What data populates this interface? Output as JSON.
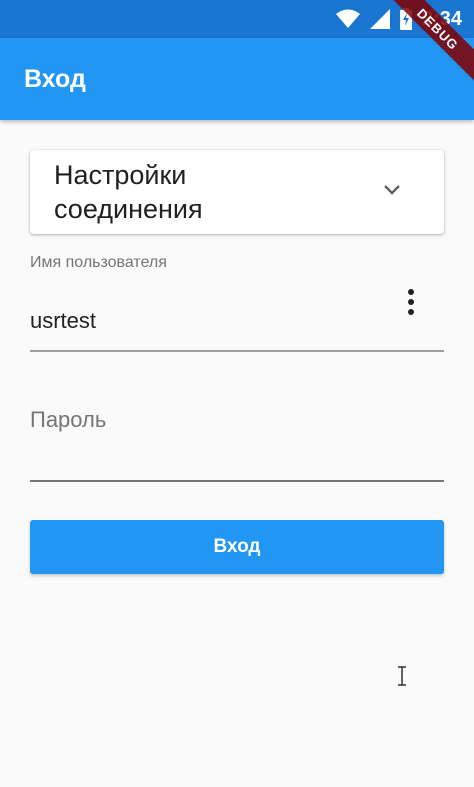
{
  "status_bar": {
    "time": "2:34",
    "icons": [
      "wifi-icon",
      "signal-icon",
      "battery-icon"
    ],
    "color": "#1976d2"
  },
  "app_bar": {
    "title": "Вход",
    "color": "#2196f3"
  },
  "debug_banner": "DEBUG",
  "form": {
    "connection_dropdown": {
      "label": "Настройки соединения",
      "icon": "chevron-down-icon"
    },
    "username": {
      "label": "Имя пользователя",
      "value": "usrtest",
      "menu_icon": "more-vert-icon"
    },
    "password": {
      "placeholder": "Пароль",
      "value": ""
    },
    "submit_label": "Вход"
  },
  "colors": {
    "accent": "#2196f3",
    "background": "#fafafa"
  }
}
